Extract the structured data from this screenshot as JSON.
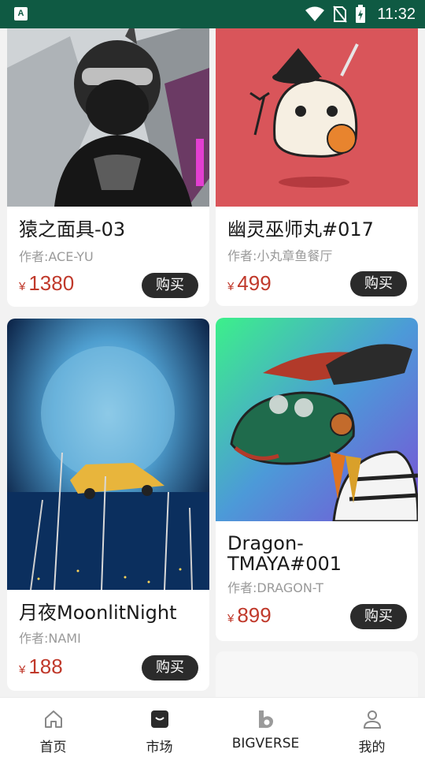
{
  "status_bar": {
    "time": "11:32",
    "app_badge": "A"
  },
  "currency_symbol": "¥",
  "buy_label": "购买",
  "cards_left": [
    {
      "title": "猿之面具-03",
      "author": "作者:ACE-YU",
      "price": "1380"
    },
    {
      "title": "月夜MoonlitNight",
      "author": "作者:NAMI",
      "price": "188"
    }
  ],
  "cards_right": [
    {
      "title": "幽灵巫师丸#017",
      "author": "作者:小丸章鱼餐厅",
      "price": "499"
    },
    {
      "title": "Dragon-TMAYA#001",
      "author": "作者:DRAGON-T",
      "price": "899"
    }
  ],
  "nav": {
    "items": [
      {
        "label": "首页",
        "icon": "home-icon"
      },
      {
        "label": "市场",
        "icon": "market-bag-icon"
      },
      {
        "label": "BIGVERSE",
        "icon": "bigverse-logo-icon"
      },
      {
        "label": "我的",
        "icon": "profile-icon"
      }
    ]
  },
  "colors": {
    "status_bar": "#0f5a43",
    "price": "#c0392b",
    "buy_button": "#2b2b2b"
  }
}
